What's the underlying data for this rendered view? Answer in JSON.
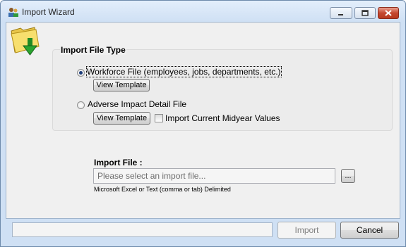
{
  "window": {
    "title": "Import Wizard"
  },
  "file_type_group": {
    "title": "Import File Type",
    "options": [
      {
        "label": "Workforce File (employees, jobs, departments, etc.)",
        "selected": true
      },
      {
        "label": "Adverse Impact Detail File",
        "selected": false
      }
    ],
    "view_template_label": "View Template",
    "midyear_checkbox_label": "Import Current Midyear Values",
    "midyear_checked": false
  },
  "import_file": {
    "label": "Import File :",
    "placeholder": "Please select an import file...",
    "browse_label": "...",
    "hint": "Microsoft Excel or Text (comma or tab) Delimited"
  },
  "footer": {
    "status_text": "",
    "import_label": "Import",
    "cancel_label": "Cancel"
  },
  "colors": {
    "title_bg": "#cfe0f4",
    "client_bg": "#f0f0f0",
    "close_button": "#c4472f",
    "radio_dot": "#1d3d7a"
  }
}
